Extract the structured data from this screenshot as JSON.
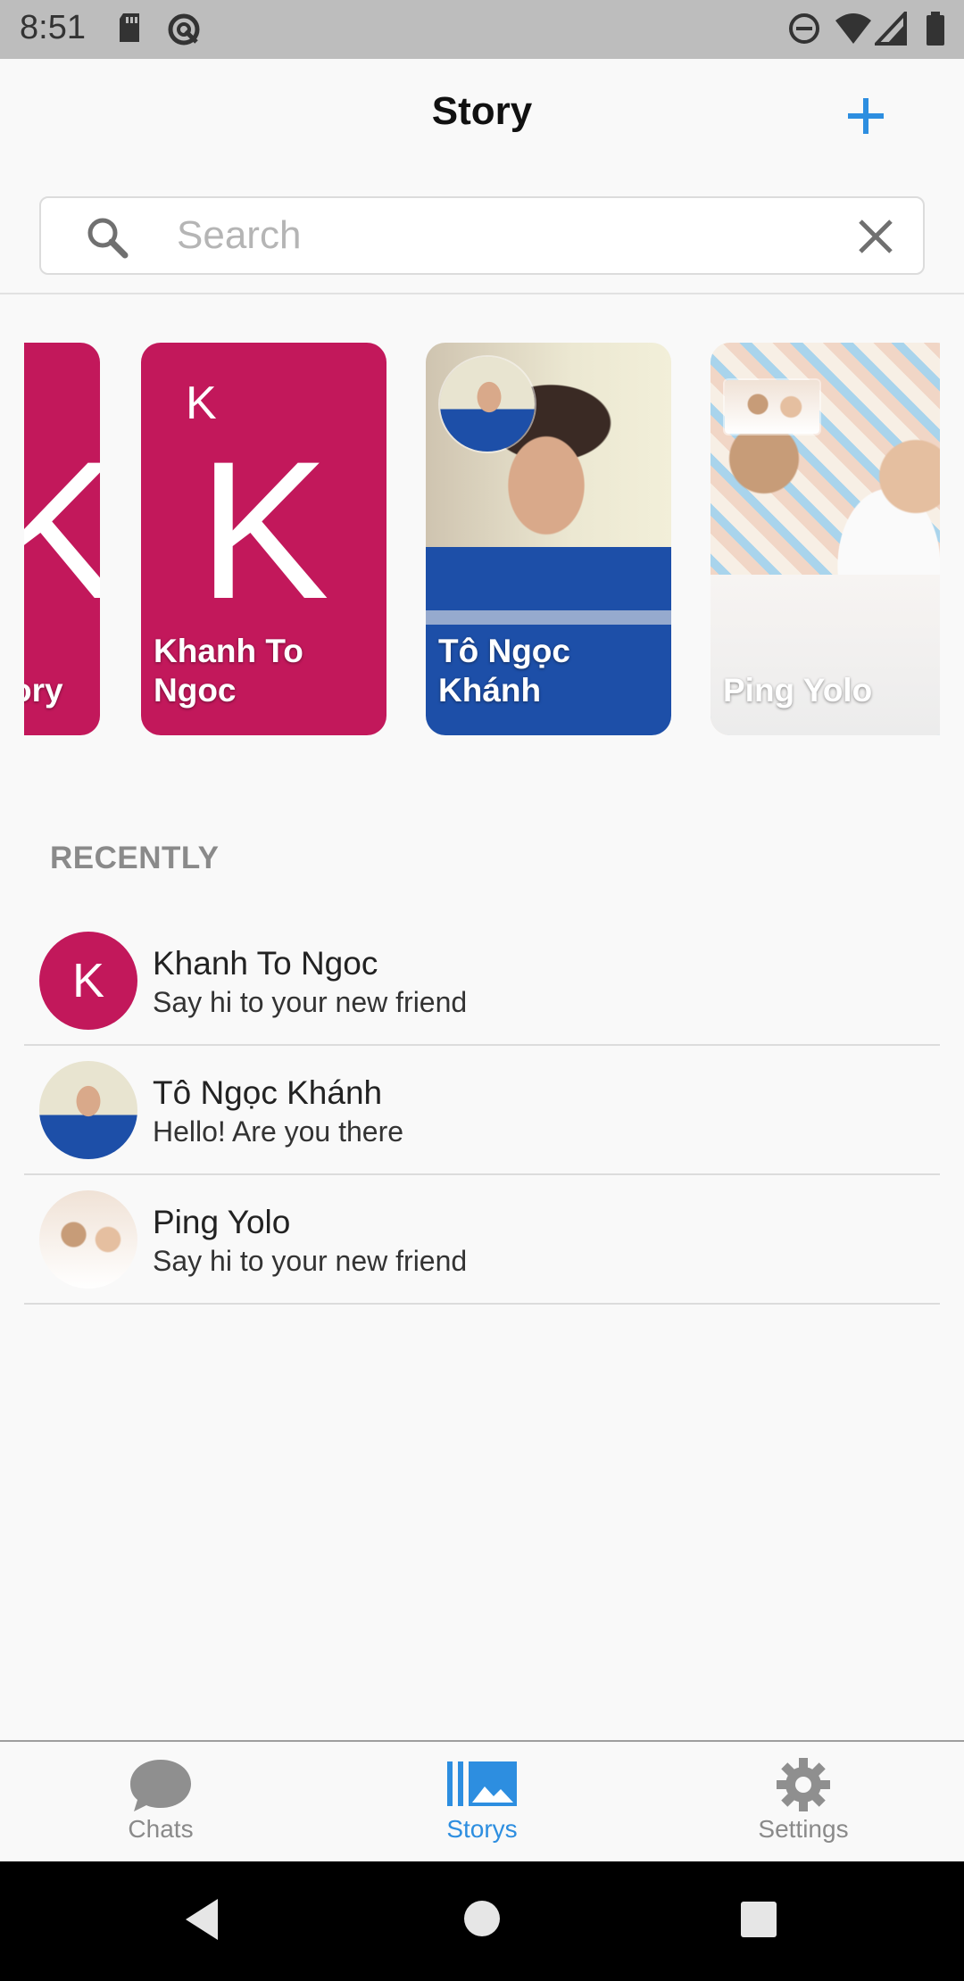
{
  "status_bar": {
    "time": "8:51"
  },
  "header": {
    "title": "Story"
  },
  "search": {
    "placeholder": "Search",
    "value": ""
  },
  "stories": [
    {
      "name": "ory",
      "type": "letter",
      "letter": "K",
      "color": "#c2185b"
    },
    {
      "name": "Khanh To Ngoc",
      "type": "letter",
      "letter": "K",
      "color": "#c2185b"
    },
    {
      "name": "Tô Ngọc Khánh",
      "type": "photo"
    },
    {
      "name": "Ping Yolo",
      "type": "photo"
    }
  ],
  "recently": {
    "title": "RECENTLY",
    "items": [
      {
        "name": "Khanh To Ngoc",
        "message": "Say hi to your new friend",
        "avatar_letter": "K"
      },
      {
        "name": "Tô Ngọc Khánh",
        "message": "Hello! Are you there"
      },
      {
        "name": "Ping Yolo",
        "message": "Say hi to your new friend"
      }
    ]
  },
  "bottom_nav": {
    "tabs": [
      {
        "label": "Chats",
        "icon": "chat-bubble-icon",
        "active": false
      },
      {
        "label": "Storys",
        "icon": "gallery-icon",
        "active": true
      },
      {
        "label": "Settings",
        "icon": "gear-icon",
        "active": false
      }
    ]
  },
  "colors": {
    "accent": "#2d8ee0",
    "story_magenta": "#c2185b",
    "status_bar": "#bdbdbd"
  }
}
